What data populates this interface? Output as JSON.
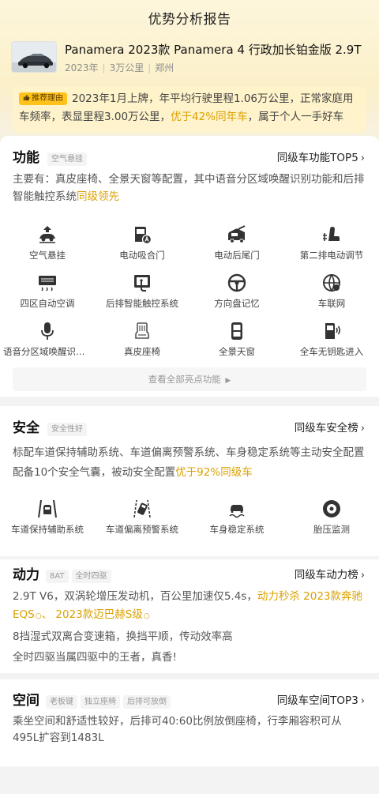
{
  "page": {
    "title": "优势分析报告"
  },
  "car": {
    "title": "Panamera 2023款 Panamera 4 行政加长铂金版 2.9T",
    "year": "2023年",
    "mileage": "3万公里",
    "city": "郑州"
  },
  "reason": {
    "badge": "推荐理由",
    "text1": "2023年1月上牌，年平均行驶里程1.06万公里，正常家庭用车频率，表显里程3.00万公里，",
    "highlight": "优于42%同年车",
    "text2": "，属于个人一手好车"
  },
  "function": {
    "title": "功能",
    "tags": [
      "空气悬挂"
    ],
    "link": "同级车功能TOP5",
    "desc": "主要有：真皮座椅、全景天窗等配置，其中语音分区域唤醒识别功能和后排智能触控系统",
    "desc_hl": "同级领先",
    "items": [
      {
        "label": "空气悬挂",
        "icon": "air-suspension-icon"
      },
      {
        "label": "电动吸合门",
        "icon": "soft-close-door-icon"
      },
      {
        "label": "电动后尾门",
        "icon": "power-tailgate-icon"
      },
      {
        "label": "第二排电动调节",
        "icon": "second-row-seat-icon"
      },
      {
        "label": "四区自动空调",
        "icon": "four-zone-ac-icon"
      },
      {
        "label": "后排智能触控系统",
        "icon": "rear-touch-control-icon"
      },
      {
        "label": "方向盘记忆",
        "icon": "steering-wheel-memory-icon"
      },
      {
        "label": "车联网",
        "icon": "connected-car-icon"
      },
      {
        "label": "语音分区域唤醒识别功能",
        "icon": "voice-zone-icon"
      },
      {
        "label": "真皮座椅",
        "icon": "leather-seat-icon"
      },
      {
        "label": "全景天窗",
        "icon": "panoramic-sunroof-icon"
      },
      {
        "label": "全车无钥匙进入",
        "icon": "keyless-entry-icon"
      }
    ],
    "viewall": "查看全部亮点功能"
  },
  "safety": {
    "title": "安全",
    "tags": [
      "安全性好"
    ],
    "link": "同级车安全榜",
    "desc1": "标配车道保持辅助系统、车道偏离预警系统、车身稳定系统等主动安全配置",
    "desc2": "配备10个安全气囊，被动安全配置",
    "desc2_hl": "优于92%同级车",
    "items": [
      {
        "label": "车道保持辅助系统",
        "icon": "lane-keep-icon"
      },
      {
        "label": "车道偏离预警系统",
        "icon": "lane-departure-icon"
      },
      {
        "label": "车身稳定系统",
        "icon": "stability-control-icon"
      },
      {
        "label": "胎压监测",
        "icon": "tire-pressure-icon"
      }
    ]
  },
  "power": {
    "title": "动力",
    "tags": [
      "8AT",
      "全时四驱"
    ],
    "link": "同级车动力榜",
    "desc1": "2.9T V6，双涡轮增压发动机，百公里加速仅5.4s，",
    "desc1_hl": "动力秒杀",
    "compare1": "2023款奔驰EQS",
    "sep": "、",
    "compare2": "2023款迈巴赫S级",
    "desc2": "8挡湿式双离合变速箱，换挡平顺，传动效率高",
    "desc3": "全时四驱当属四驱中的王者，真香!"
  },
  "space": {
    "title": "空间",
    "tags": [
      "老板键",
      "独立座椅",
      "后排可放倒"
    ],
    "link": "同级车空间TOP3",
    "desc": "乘坐空间和舒适性较好，后排可40:60比例放倒座椅，行李厢容积可从495L扩容到1483L"
  },
  "colors": {
    "accent": "#dba100",
    "badge": "#ffc21a"
  }
}
